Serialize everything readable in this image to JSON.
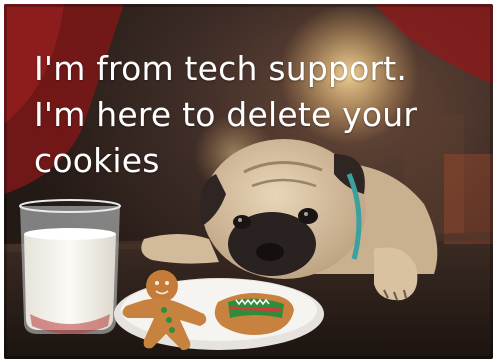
{
  "meme": {
    "caption_lines": [
      "I'm from tech support.",
      "I'm here to delete your",
      "cookies"
    ]
  },
  "scene": {
    "subjects": [
      "pug-dog",
      "glass-of-milk",
      "gingerbread-man-cookie",
      "gingerbread-sweater-cookie",
      "plate"
    ],
    "colors": {
      "background_dark": "#3a2a25",
      "curtain_red": "#8c1a1a",
      "lamp_glow": "#e8b96a",
      "table": "#2b1f1a",
      "pug_fur": "#d9c3a3",
      "pug_mask": "#2a2220",
      "milk": "#f3f1ea",
      "cookie": "#c8823f",
      "plate": "#f4f2ee"
    }
  }
}
